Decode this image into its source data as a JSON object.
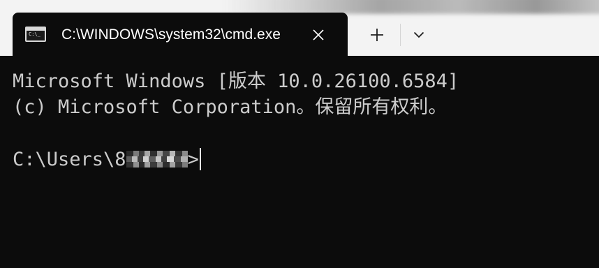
{
  "window": {
    "tab": {
      "title": "C:\\WINDOWS\\system32\\cmd.exe",
      "icon": "cmd-icon",
      "icon_prompt": "C:\\_",
      "close_icon": "close-icon"
    },
    "new_tab_icon": "plus-icon",
    "dropdown_icon": "chevron-down-icon"
  },
  "console": {
    "line1": "Microsoft Windows [版本 10.0.26100.6584]",
    "line2": "(c) Microsoft Corporation。保留所有权利。",
    "prompt_prefix": "C:\\Users\\8",
    "prompt_suffix": ">"
  },
  "colors": {
    "console_bg": "#0c0c0c",
    "console_text": "#cccccc",
    "titlebar_bg": "#f3f3f3",
    "tab_text": "#ffffff"
  }
}
